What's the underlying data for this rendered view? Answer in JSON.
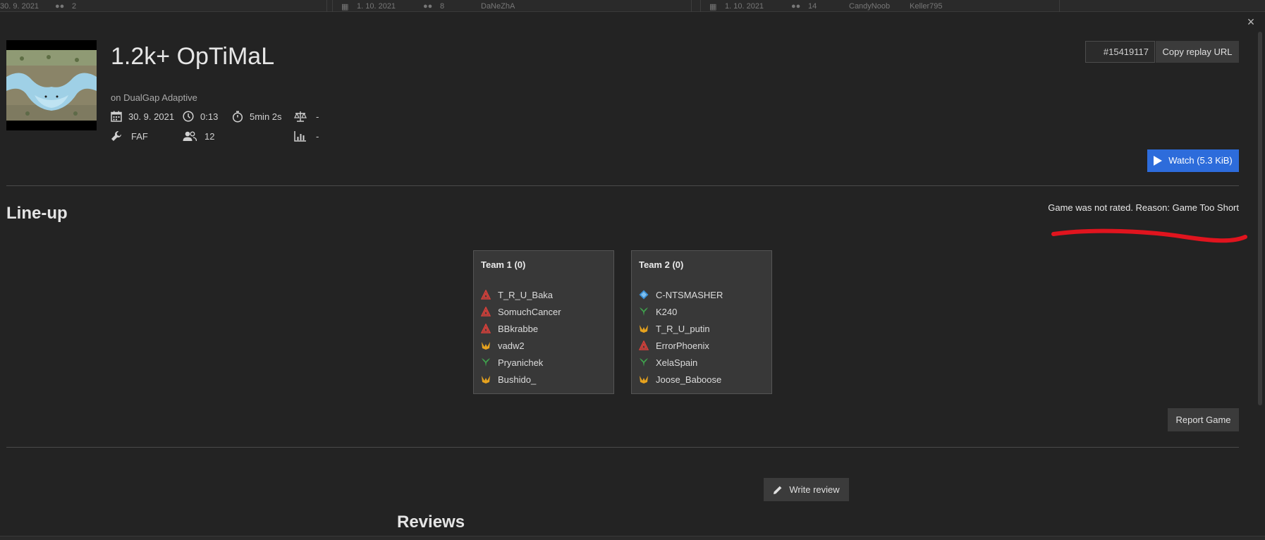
{
  "background_cards": [
    {
      "date": "30. 9. 2021",
      "players": "2",
      "names": []
    },
    {
      "date": "1. 10. 2021",
      "players": "8",
      "names": [
        "DaNeZhA"
      ]
    },
    {
      "date": "1. 10. 2021",
      "players": "14",
      "names": [
        "CandyNoob",
        "Keller795"
      ]
    }
  ],
  "game": {
    "title": "1.2k+ OpTiMaL",
    "map_name": "on DualGap Adaptive",
    "date": "30. 9. 2021",
    "start_time": "0:13",
    "duration": "5min 2s",
    "rating_balance": "-",
    "featured_mod": "FAF",
    "player_count": "12",
    "average_rating": "-",
    "replay_id": "#15419117"
  },
  "buttons": {
    "copy_replay_url": "Copy replay URL",
    "watch": "Watch (5.3 KiB)",
    "report_game": "Report Game",
    "write_review": "Write review",
    "close": "×"
  },
  "lineup": {
    "title": "Line-up",
    "rating_notice": "Game was not rated. Reason: Game Too Short",
    "teams": [
      {
        "name": "Team 1 (0)",
        "players": [
          {
            "name": "T_R_U_Baka",
            "faction": "cybran"
          },
          {
            "name": "SomuchCancer",
            "faction": "cybran"
          },
          {
            "name": "BBkrabbe",
            "faction": "cybran"
          },
          {
            "name": "vadw2",
            "faction": "seraphim"
          },
          {
            "name": "Pryanichek",
            "faction": "aeon"
          },
          {
            "name": "Bushido_",
            "faction": "seraphim"
          }
        ]
      },
      {
        "name": "Team 2 (0)",
        "players": [
          {
            "name": "C-NTSMASHER",
            "faction": "uef"
          },
          {
            "name": "K240",
            "faction": "aeon"
          },
          {
            "name": "T_R_U_putin",
            "faction": "seraphim"
          },
          {
            "name": "ErrorPhoenix",
            "faction": "cybran"
          },
          {
            "name": "XelaSpain",
            "faction": "aeon"
          },
          {
            "name": "Joose_Baboose",
            "faction": "seraphim"
          }
        ]
      }
    ]
  },
  "reviews": {
    "title": "Reviews"
  },
  "colors": {
    "cybran": "#d9403a",
    "aeon": "#3fa34d",
    "uef": "#3b8fd6",
    "seraphim": "#e6a21e",
    "accent": "#2d6cdb",
    "annotation": "#e0141e"
  }
}
